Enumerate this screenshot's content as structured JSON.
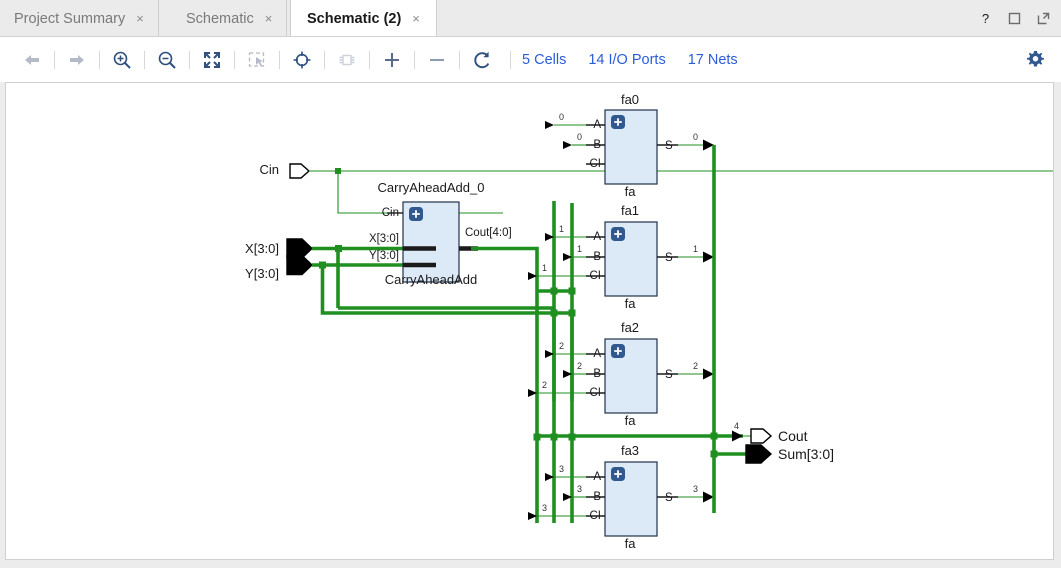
{
  "window": {
    "buttons": [
      {
        "name": "help-button",
        "glyph": "?"
      },
      {
        "name": "maximize-button",
        "glyph": "❐"
      },
      {
        "name": "float-button",
        "glyph": "↗"
      }
    ]
  },
  "tabs": [
    {
      "label": "Project Summary",
      "close": "×",
      "active": false
    },
    {
      "label": "Schematic",
      "close": "×",
      "active": false
    },
    {
      "label": "Schematic (2)",
      "close": "×",
      "active": true
    }
  ],
  "toolbar": {
    "icons": [
      {
        "name": "back-icon",
        "title": "Back"
      },
      {
        "name": "forward-icon",
        "title": "Forward"
      },
      {
        "name": "zoom-in-icon",
        "title": "Zoom In"
      },
      {
        "name": "zoom-out-icon",
        "title": "Zoom Out"
      },
      {
        "name": "zoom-fit-icon",
        "title": "Zoom Fit"
      },
      {
        "name": "zoom-area-icon",
        "title": "Zoom Area"
      },
      {
        "name": "crosshair-icon",
        "title": "Center"
      },
      {
        "name": "chip-icon",
        "title": "Expand Cell"
      },
      {
        "name": "plus-icon",
        "title": "Add"
      },
      {
        "name": "minus-icon",
        "title": "Remove"
      },
      {
        "name": "refresh-icon",
        "title": "Reload"
      }
    ],
    "stats": [
      {
        "name": "cells-link",
        "label": "5 Cells"
      },
      {
        "name": "io-ports-link",
        "label": "14 I/O Ports"
      },
      {
        "name": "nets-link",
        "label": "17 Nets"
      }
    ],
    "settings": {
      "name": "gear-icon",
      "label": "Settings"
    },
    "link_color": "#2a5ddb"
  },
  "schematic": {
    "colors": {
      "wire": "#1f8f1f",
      "cell_fill": "#dce9f7",
      "cell_stroke": "#20324a",
      "badge": "#31598f"
    },
    "input_ports": [
      {
        "name": "port-cin",
        "label": "Cin",
        "type": "bit"
      },
      {
        "name": "port-x",
        "label": "X[3:0]",
        "type": "bus"
      },
      {
        "name": "port-y",
        "label": "Y[3:0]",
        "type": "bus"
      }
    ],
    "output_ports": [
      {
        "name": "port-cout",
        "label": "Cout",
        "type": "bit"
      },
      {
        "name": "port-sum",
        "label": "Sum[3:0]",
        "type": "bus"
      }
    ],
    "cla": {
      "instance": "CarryAheadAdd_0",
      "master": "CarryAheadAdd",
      "inputs": [
        "Cin",
        "X[3:0]",
        "Y[3:0]"
      ],
      "outputs": [
        "Cout[4:0]"
      ],
      "badge": "+"
    },
    "adders": [
      {
        "instance": "fa0",
        "master": "fa",
        "inputs": [
          "A",
          "B",
          "CI"
        ],
        "output": "S",
        "bit": "0",
        "badge": "+"
      },
      {
        "instance": "fa1",
        "master": "fa",
        "inputs": [
          "A",
          "B",
          "CI"
        ],
        "output": "S",
        "bit": "1",
        "badge": "+"
      },
      {
        "instance": "fa2",
        "master": "fa",
        "inputs": [
          "A",
          "B",
          "CI"
        ],
        "output": "S",
        "bit": "2",
        "badge": "+"
      },
      {
        "instance": "fa3",
        "master": "fa",
        "inputs": [
          "A",
          "B",
          "CI"
        ],
        "output": "S",
        "bit": "3",
        "badge": "+"
      }
    ],
    "cout_bit": "4"
  }
}
